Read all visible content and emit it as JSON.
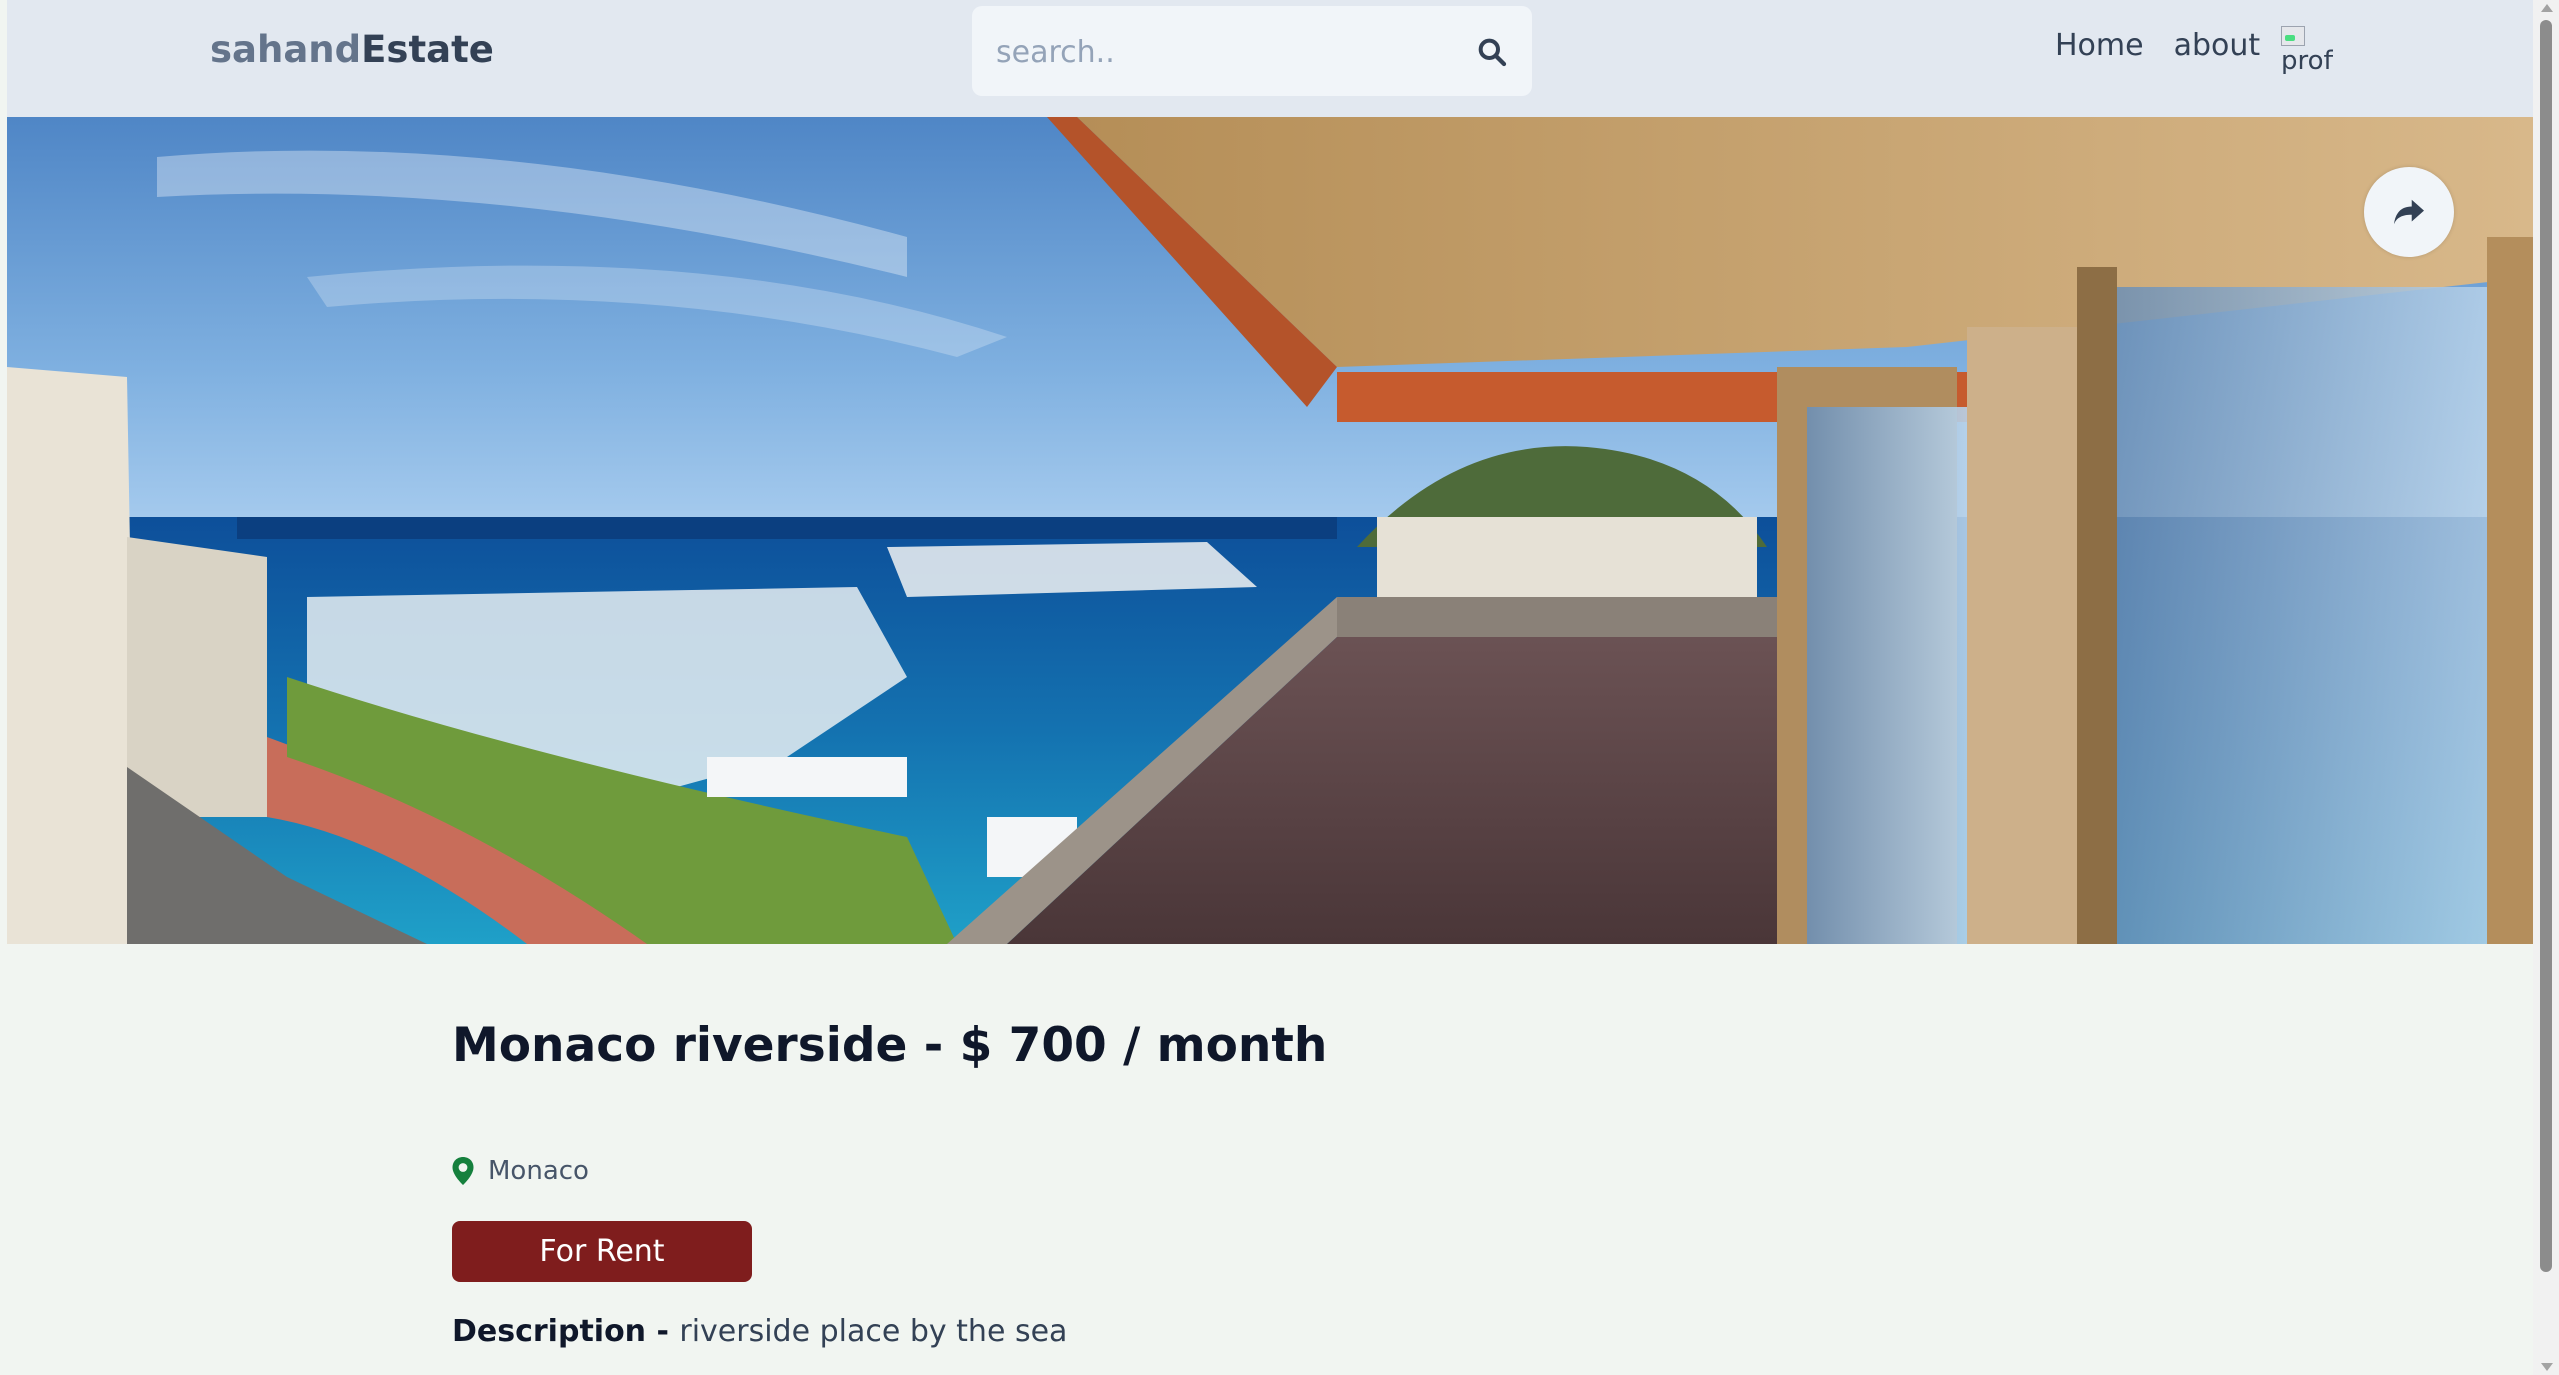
{
  "header": {
    "logo_part1": "sahand",
    "logo_part2": "Estate",
    "search": {
      "placeholder": "search..",
      "value": ""
    },
    "nav": {
      "home_label": "Home",
      "about_label": "about"
    },
    "avatar_alt": "profile"
  },
  "listing": {
    "title": "Monaco riverside - $ 700 / month",
    "location": "Monaco",
    "type_badge": "For Rent",
    "description_label": "Description - ",
    "description": "riverside place by the sea"
  },
  "colors": {
    "header_bg": "#e2e8f0",
    "page_bg": "#f1f5f1",
    "badge_bg": "#7f1d1d",
    "pin_icon": "#15803d"
  },
  "icons": [
    "search-icon",
    "share-icon",
    "map-pin-icon"
  ]
}
